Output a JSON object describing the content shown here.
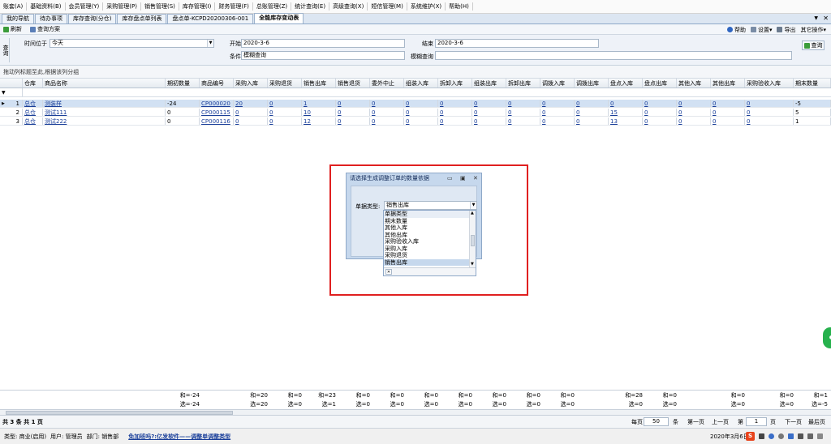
{
  "menu": [
    "账套(A)",
    "基础资料(B)",
    "会员管理(Y)",
    "采购管理(P)",
    "销售管理(S)",
    "库存管理(I)",
    "财务管理(F)",
    "总账管理(Z)",
    "统计查询(E)",
    "高级查询(X)",
    "短信管理(M)",
    "系统维护(X)",
    "帮助(H)"
  ],
  "tabs": [
    "我的导航",
    "待办事项",
    "库存查询(分仓)",
    "库存盘点单列表",
    "盘点单-KCPD20200306-001",
    "全能库存变动表"
  ],
  "toolbar": {
    "refresh": "刷新",
    "query_plan": "查询方案",
    "help": "帮助",
    "settings": "设置",
    "export": "导出",
    "other": "其它操作"
  },
  "filter": {
    "side_label": "查询",
    "time_label": "时间位于",
    "time_value": "今天",
    "start_label": "开始",
    "start_value": "2020-3-6",
    "end_label": "结束",
    "end_value": "2020-3-6",
    "cond_label": "条件",
    "cond_value": "模糊查询",
    "fuzzy_label": "模糊查询",
    "fuzzy_value": "",
    "query_button": "查询"
  },
  "group_hint": "拖动列标题至此,根据该列分组",
  "grid": {
    "headers": [
      "",
      "仓库",
      "商品名称",
      "期初数量",
      "商品编号",
      "采购入库",
      "采购退货",
      "销售出库",
      "销售退货",
      "委外中止",
      "组装入库",
      "拆卸入库",
      "组装出库",
      "拆卸出库",
      "调拨入库",
      "调拨出库",
      "盘点入库",
      "盘点出库",
      "其他入库",
      "其他出库",
      "采购验收入库",
      "期末数量"
    ],
    "rows": [
      {
        "n": "1",
        "wh": "总仓",
        "name": "测装样",
        "open": "-24",
        "code": "CP000020",
        "vals": [
          "20",
          "0",
          "1",
          "0",
          "0",
          "0",
          "0",
          "0",
          "0",
          "0",
          "0",
          "0",
          "0",
          "0",
          "0",
          "0"
        ],
        "close": "-5"
      },
      {
        "n": "2",
        "wh": "总仓",
        "name": "测试111",
        "open": "0",
        "code": "CP000115",
        "vals": [
          "0",
          "0",
          "10",
          "0",
          "0",
          "0",
          "0",
          "0",
          "0",
          "0",
          "0",
          "15",
          "0",
          "0",
          "0",
          "0"
        ],
        "close": "5"
      },
      {
        "n": "3",
        "wh": "总仓",
        "name": "测试222",
        "open": "0",
        "code": "CP000116",
        "vals": [
          "0",
          "0",
          "12",
          "0",
          "0",
          "0",
          "0",
          "0",
          "0",
          "0",
          "0",
          "13",
          "0",
          "0",
          "0",
          "0"
        ],
        "close": "1"
      }
    ]
  },
  "summary": {
    "r1": [
      "和=-24",
      "和=20",
      "和=0",
      "和=23",
      "和=0",
      "和=0",
      "和=0",
      "和=0",
      "和=0",
      "和=0",
      "和=0",
      "和=28",
      "和=0",
      "和=0",
      "和=0",
      "和=1"
    ],
    "r2": [
      "选=-24",
      "选=20",
      "选=0",
      "选=1",
      "选=0",
      "选=0",
      "选=0",
      "选=0",
      "选=0",
      "选=0",
      "选=0",
      "选=0",
      "选=0",
      "选=0",
      "选=0",
      "选=-5"
    ]
  },
  "pager": {
    "count": "共 3 条  共 1 页",
    "per_page_label": "每页",
    "per_page": "50",
    "per_unit": "条",
    "first": "第一页",
    "prev": "上一页",
    "page_label": "第",
    "page": "1",
    "page_unit": "页",
    "next": "下一页",
    "last": "最后页"
  },
  "status": {
    "type": "类型: 商业(启用)",
    "user": "用户: 管理员",
    "dept": "部门: 销售部",
    "link": "免加班吗?:亿发软件——调整单调整类型",
    "date": "2020年3月6日"
  },
  "dialog": {
    "title": "请选择生成调整订单的数量依据",
    "doc_type_label": "单据类型:",
    "doc_type_value": "销售出库",
    "options": [
      "单据类型",
      "期末数量",
      "其他入库",
      "其他出库",
      "采购验收入库",
      "采购入库",
      "采购退货",
      "销售出库"
    ],
    "highlight_index": 7
  },
  "colors": {
    "accent": "#1a3f9a",
    "selected_row": "#d2e1f3",
    "highlight_box": "#e02020"
  },
  "icons": [
    "refresh-icon",
    "query-plan-icon",
    "help-icon",
    "settings-icon",
    "export-icon",
    "other-ops-icon",
    "query-icon",
    "dropdown-arrow-icon",
    "close-icon",
    "minimize-icon",
    "maximize-icon"
  ]
}
